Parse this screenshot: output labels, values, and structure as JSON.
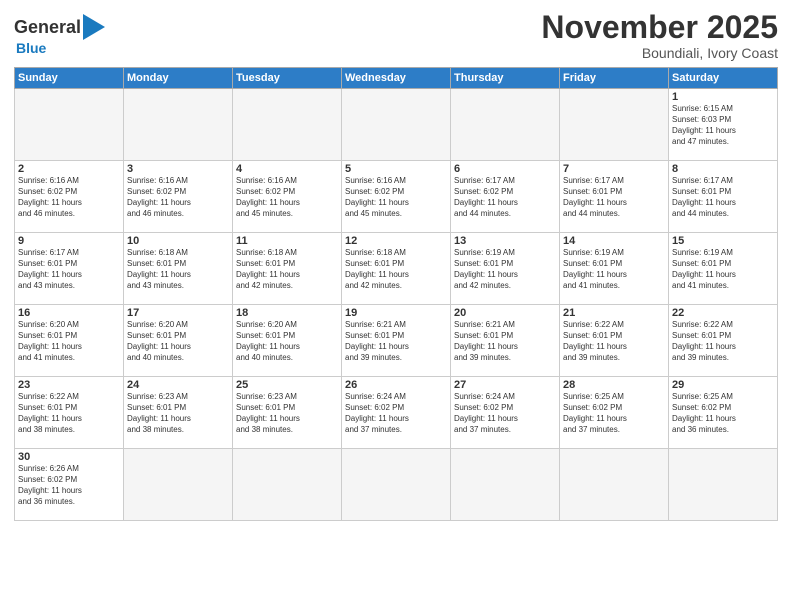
{
  "header": {
    "logo_general": "General",
    "logo_blue": "Blue",
    "month_title": "November 2025",
    "location": "Boundiali, Ivory Coast"
  },
  "days_of_week": [
    "Sunday",
    "Monday",
    "Tuesday",
    "Wednesday",
    "Thursday",
    "Friday",
    "Saturday"
  ],
  "weeks": [
    [
      {
        "day": "",
        "info": ""
      },
      {
        "day": "",
        "info": ""
      },
      {
        "day": "",
        "info": ""
      },
      {
        "day": "",
        "info": ""
      },
      {
        "day": "",
        "info": ""
      },
      {
        "day": "",
        "info": ""
      },
      {
        "day": "1",
        "info": "Sunrise: 6:15 AM\nSunset: 6:03 PM\nDaylight: 11 hours\nand 47 minutes."
      }
    ],
    [
      {
        "day": "2",
        "info": "Sunrise: 6:16 AM\nSunset: 6:02 PM\nDaylight: 11 hours\nand 46 minutes."
      },
      {
        "day": "3",
        "info": "Sunrise: 6:16 AM\nSunset: 6:02 PM\nDaylight: 11 hours\nand 46 minutes."
      },
      {
        "day": "4",
        "info": "Sunrise: 6:16 AM\nSunset: 6:02 PM\nDaylight: 11 hours\nand 45 minutes."
      },
      {
        "day": "5",
        "info": "Sunrise: 6:16 AM\nSunset: 6:02 PM\nDaylight: 11 hours\nand 45 minutes."
      },
      {
        "day": "6",
        "info": "Sunrise: 6:17 AM\nSunset: 6:02 PM\nDaylight: 11 hours\nand 44 minutes."
      },
      {
        "day": "7",
        "info": "Sunrise: 6:17 AM\nSunset: 6:01 PM\nDaylight: 11 hours\nand 44 minutes."
      },
      {
        "day": "8",
        "info": "Sunrise: 6:17 AM\nSunset: 6:01 PM\nDaylight: 11 hours\nand 44 minutes."
      }
    ],
    [
      {
        "day": "9",
        "info": "Sunrise: 6:17 AM\nSunset: 6:01 PM\nDaylight: 11 hours\nand 43 minutes."
      },
      {
        "day": "10",
        "info": "Sunrise: 6:18 AM\nSunset: 6:01 PM\nDaylight: 11 hours\nand 43 minutes."
      },
      {
        "day": "11",
        "info": "Sunrise: 6:18 AM\nSunset: 6:01 PM\nDaylight: 11 hours\nand 42 minutes."
      },
      {
        "day": "12",
        "info": "Sunrise: 6:18 AM\nSunset: 6:01 PM\nDaylight: 11 hours\nand 42 minutes."
      },
      {
        "day": "13",
        "info": "Sunrise: 6:19 AM\nSunset: 6:01 PM\nDaylight: 11 hours\nand 42 minutes."
      },
      {
        "day": "14",
        "info": "Sunrise: 6:19 AM\nSunset: 6:01 PM\nDaylight: 11 hours\nand 41 minutes."
      },
      {
        "day": "15",
        "info": "Sunrise: 6:19 AM\nSunset: 6:01 PM\nDaylight: 11 hours\nand 41 minutes."
      }
    ],
    [
      {
        "day": "16",
        "info": "Sunrise: 6:20 AM\nSunset: 6:01 PM\nDaylight: 11 hours\nand 41 minutes."
      },
      {
        "day": "17",
        "info": "Sunrise: 6:20 AM\nSunset: 6:01 PM\nDaylight: 11 hours\nand 40 minutes."
      },
      {
        "day": "18",
        "info": "Sunrise: 6:20 AM\nSunset: 6:01 PM\nDaylight: 11 hours\nand 40 minutes."
      },
      {
        "day": "19",
        "info": "Sunrise: 6:21 AM\nSunset: 6:01 PM\nDaylight: 11 hours\nand 39 minutes."
      },
      {
        "day": "20",
        "info": "Sunrise: 6:21 AM\nSunset: 6:01 PM\nDaylight: 11 hours\nand 39 minutes."
      },
      {
        "day": "21",
        "info": "Sunrise: 6:22 AM\nSunset: 6:01 PM\nDaylight: 11 hours\nand 39 minutes."
      },
      {
        "day": "22",
        "info": "Sunrise: 6:22 AM\nSunset: 6:01 PM\nDaylight: 11 hours\nand 39 minutes."
      }
    ],
    [
      {
        "day": "23",
        "info": "Sunrise: 6:22 AM\nSunset: 6:01 PM\nDaylight: 11 hours\nand 38 minutes."
      },
      {
        "day": "24",
        "info": "Sunrise: 6:23 AM\nSunset: 6:01 PM\nDaylight: 11 hours\nand 38 minutes."
      },
      {
        "day": "25",
        "info": "Sunrise: 6:23 AM\nSunset: 6:01 PM\nDaylight: 11 hours\nand 38 minutes."
      },
      {
        "day": "26",
        "info": "Sunrise: 6:24 AM\nSunset: 6:02 PM\nDaylight: 11 hours\nand 37 minutes."
      },
      {
        "day": "27",
        "info": "Sunrise: 6:24 AM\nSunset: 6:02 PM\nDaylight: 11 hours\nand 37 minutes."
      },
      {
        "day": "28",
        "info": "Sunrise: 6:25 AM\nSunset: 6:02 PM\nDaylight: 11 hours\nand 37 minutes."
      },
      {
        "day": "29",
        "info": "Sunrise: 6:25 AM\nSunset: 6:02 PM\nDaylight: 11 hours\nand 36 minutes."
      }
    ],
    [
      {
        "day": "30",
        "info": "Sunrise: 6:26 AM\nSunset: 6:02 PM\nDaylight: 11 hours\nand 36 minutes."
      },
      {
        "day": "",
        "info": ""
      },
      {
        "day": "",
        "info": ""
      },
      {
        "day": "",
        "info": ""
      },
      {
        "day": "",
        "info": ""
      },
      {
        "day": "",
        "info": ""
      },
      {
        "day": "",
        "info": ""
      }
    ]
  ]
}
